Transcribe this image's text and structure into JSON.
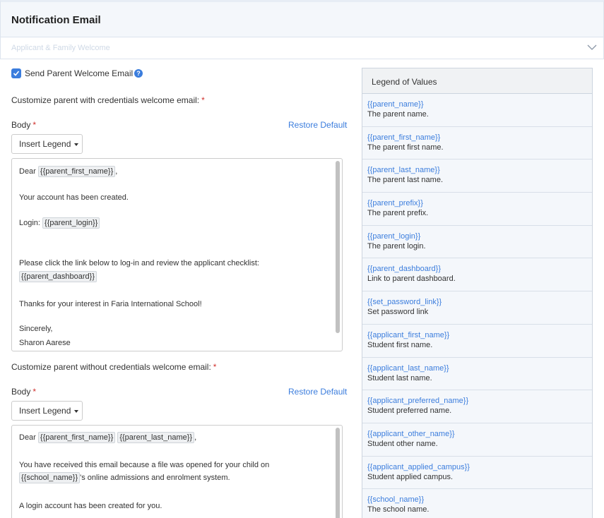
{
  "page": {
    "title": "Notification Email"
  },
  "accordion": {
    "label": "Applicant & Family Welcome"
  },
  "welcome": {
    "checkbox_label": "Send Parent Welcome Email",
    "help": "?"
  },
  "with_creds": {
    "section_label": "Customize parent with credentials welcome email:",
    "required": "*",
    "body_label": "Body",
    "restore": "Restore Default",
    "insert": "Insert Legend",
    "lines": {
      "l1_pre": "Dear",
      "l1_tok": "{{parent_first_name}}",
      "l1_post": ",",
      "l2": "Your account has been created.",
      "l3_pre": "Login:",
      "l3_tok": "{{parent_login}}",
      "l4": "Please click the link below to log-in and review the applicant checklist:",
      "l5_tok": "{{parent_dashboard}}",
      "l6": "Thanks for your interest in Faria International School!",
      "l7": "Sincerely,",
      "l8": "Sharon Aarese"
    }
  },
  "without_creds": {
    "section_label": "Customize parent without credentials welcome email:",
    "required": "*",
    "body_label": "Body",
    "restore": "Restore Default",
    "insert": "Insert Legend",
    "lines": {
      "l1_pre": "Dear",
      "l1_tok1": "{{parent_first_name}}",
      "l1_tok2": "{{parent_last_name}}",
      "l1_post": ",",
      "l2": "You have received this email because a file was opened for your child on",
      "l3_tok": "{{school_name}}",
      "l3_post": "'s online admissions and enrolment system.",
      "l4": "A login account has been created for you."
    }
  },
  "legend": {
    "title": "Legend of Values",
    "items": [
      {
        "code": "{{parent_name}}",
        "desc": "The parent name."
      },
      {
        "code": "{{parent_first_name}}",
        "desc": "The parent first name."
      },
      {
        "code": "{{parent_last_name}}",
        "desc": "The parent last name."
      },
      {
        "code": "{{parent_prefix}}",
        "desc": "The parent prefix."
      },
      {
        "code": "{{parent_login}}",
        "desc": "The parent login."
      },
      {
        "code": "{{parent_dashboard}}",
        "desc": "Link to parent dashboard."
      },
      {
        "code": "{{set_password_link}}",
        "desc": "Set password link"
      },
      {
        "code": "{{applicant_first_name}}",
        "desc": "Student first name."
      },
      {
        "code": "{{applicant_last_name}}",
        "desc": "Student last name."
      },
      {
        "code": "{{applicant_preferred_name}}",
        "desc": "Student preferred name."
      },
      {
        "code": "{{applicant_other_name}}",
        "desc": "Student other name."
      },
      {
        "code": "{{applicant_applied_campus}}",
        "desc": "Student applied campus."
      },
      {
        "code": "{{school_name}}",
        "desc": "The school name."
      }
    ]
  },
  "colors": {
    "accent": "#3b7ddd",
    "required": "#d0312d",
    "header_bg": "#f4f7fb"
  }
}
